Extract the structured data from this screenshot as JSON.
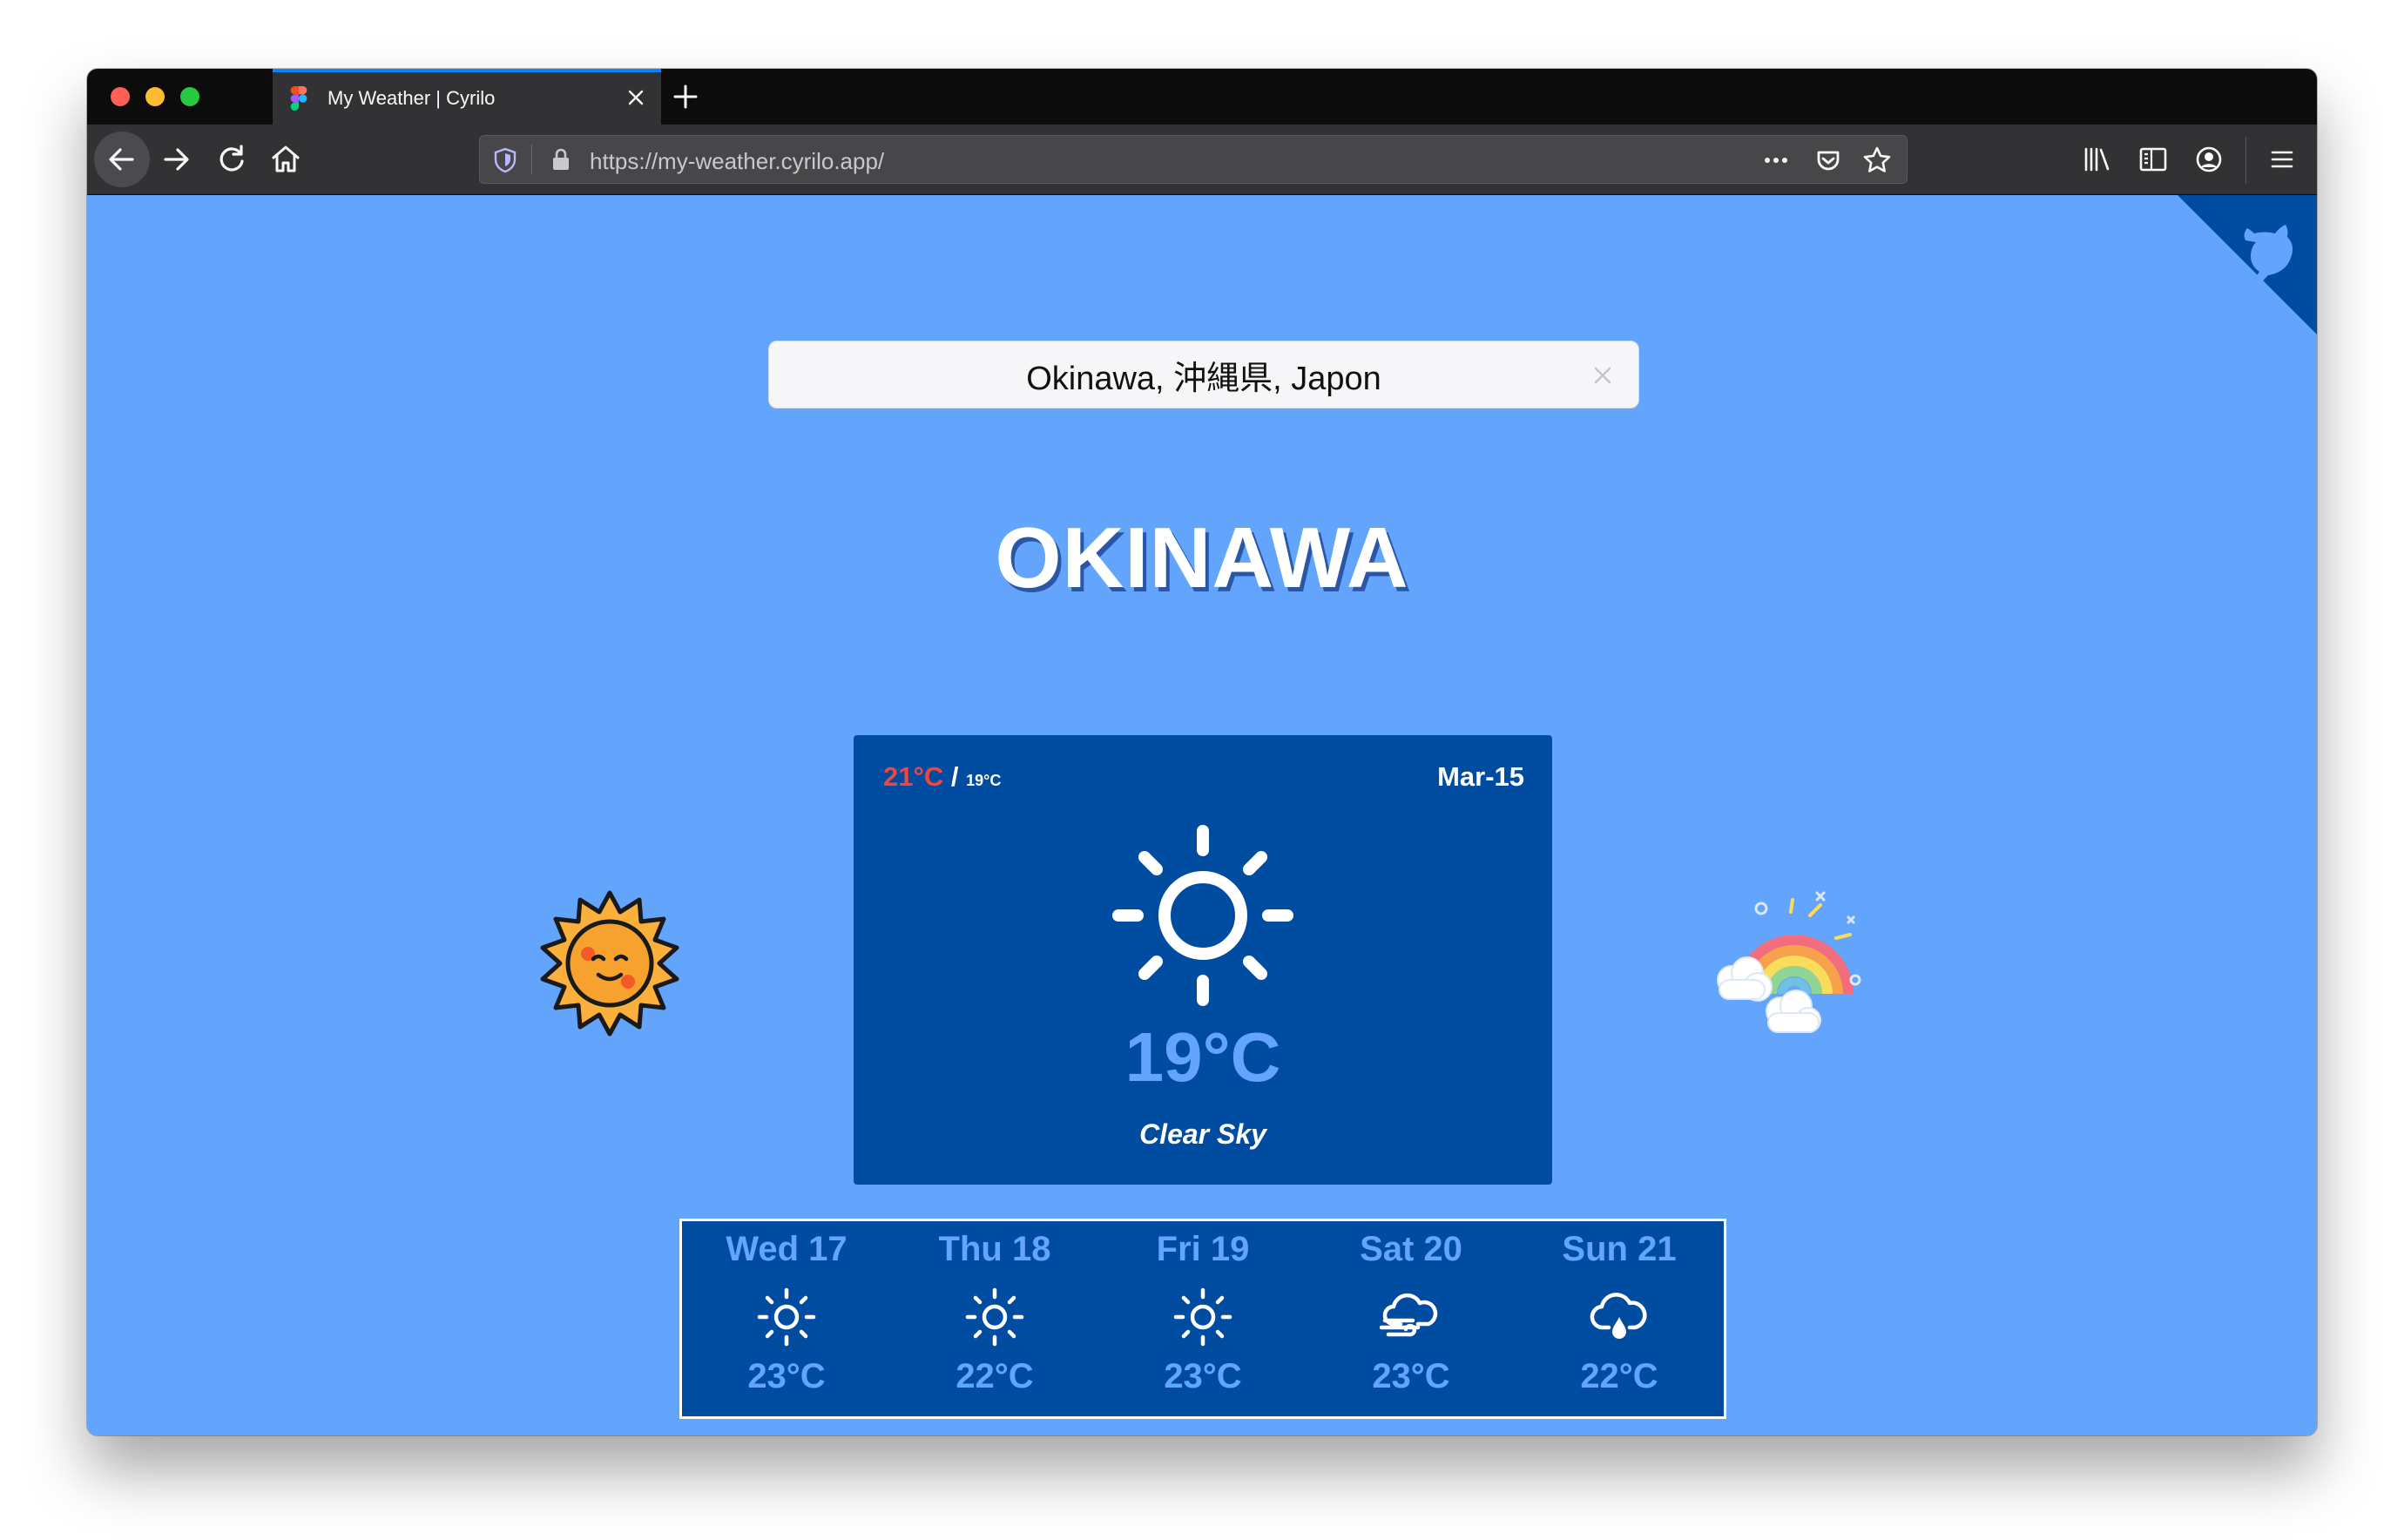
{
  "browser": {
    "tab_title": "My Weather | Cyrilo",
    "url": "https://my-weather.cyrilo.app/"
  },
  "search": {
    "value": "Okinawa, 沖縄県, Japon"
  },
  "city": {
    "name": "OKINAWA"
  },
  "today": {
    "high": "21°C",
    "separator": "/",
    "low": "19°C",
    "date": "Mar-15",
    "icon": "sun-icon",
    "temperature": "19°C",
    "description": "Clear Sky"
  },
  "forecast": [
    {
      "day": "Wed 17",
      "icon": "sun-icon",
      "temp": "23°C"
    },
    {
      "day": "Thu 18",
      "icon": "sun-icon",
      "temp": "22°C"
    },
    {
      "day": "Fri 19",
      "icon": "sun-icon",
      "temp": "23°C"
    },
    {
      "day": "Sat 20",
      "icon": "wind-cloud-icon",
      "temp": "23°C"
    },
    {
      "day": "Sun 21",
      "icon": "rain-cloud-icon",
      "temp": "22°C"
    }
  ],
  "colors": {
    "background": "#63a4fc",
    "card": "#004ca1",
    "accent_text": "#63a4fc",
    "high_temp": "#f2453c"
  }
}
